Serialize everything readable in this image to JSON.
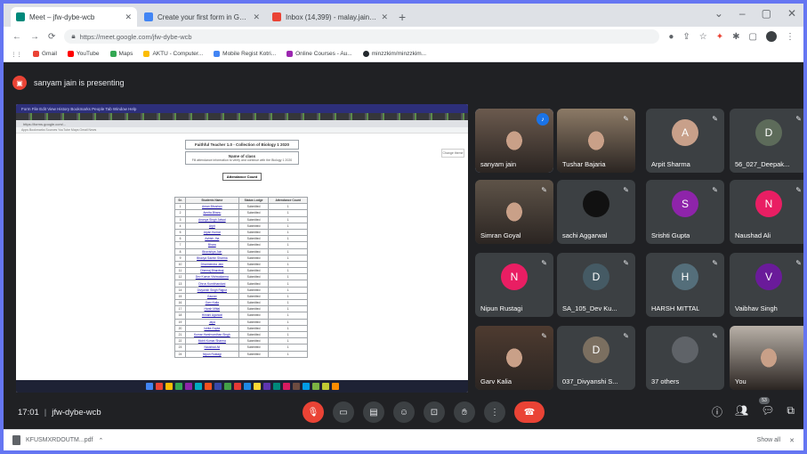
{
  "browser": {
    "tabs": [
      {
        "title": "Meet – jfw-dybe-wcb",
        "color": "#00897b",
        "active": true
      },
      {
        "title": "Create your first form in Google...",
        "color": "#4285f4",
        "active": false
      },
      {
        "title": "Inbox (14,399) - malay.jain@...",
        "color": "#ea4335",
        "active": false
      }
    ],
    "new_tab": "+",
    "window_controls": [
      "⌄",
      "–",
      "▢",
      "✕"
    ],
    "back": "←",
    "forward": "→",
    "reload": "⟳",
    "url": "https://meet.google.com/jfw-dybe-wcb",
    "bookmarks": [
      {
        "label": "Gmail",
        "color": "#ea4335"
      },
      {
        "label": "YouTube",
        "color": "#ff0000"
      },
      {
        "label": "Maps",
        "color": "#34a853"
      },
      {
        "label": "AKTU - Computer...",
        "color": "#fbbc04"
      },
      {
        "label": "Mobile Regist Kotri...",
        "color": "#4285f4"
      },
      {
        "label": "Online Courses - Au...",
        "color": "#9c27b0"
      },
      {
        "label": "minzzkim/minzzkim...",
        "color": "#24292e"
      }
    ]
  },
  "meet": {
    "presenting": "sanyam jain is presenting",
    "screen": {
      "title_bar": "Form  File  Edit  View  History  Bookmarks  People  Tab  Window  Help",
      "address": "https://forms.google.com/...",
      "bookmarks_line": "Apps  Bookmarks  Sources  YouTube  Maps  Gmail  News",
      "side_note": "Change theme",
      "doc_title": "Faithful Teacher 1.0 - Collection of Biology 1 2020",
      "doc_subtitle": "Name of class",
      "doc_desc": "Fill attendance information to verify and continue with the Biology 1 2020",
      "attendance_button": "Attendance Count",
      "table_headers": [
        "Sr.",
        "Students Name",
        "Status Lodge",
        "Attendance Count"
      ],
      "rows": [
        [
          "1",
          "Aman Bhushan",
          "Submitted",
          "1"
        ],
        [
          "2",
          "Amrita Bhanu",
          "Submitted",
          "1"
        ],
        [
          "3",
          "Ananya Singh Jalwal",
          "Submitted",
          "1"
        ],
        [
          "4",
          "Arpit",
          "Submitted",
          "1"
        ],
        [
          "5",
          "Aryan Kumar",
          "Submitted",
          "1"
        ],
        [
          "6",
          "Ashish Jha",
          "Submitted",
          "1"
        ],
        [
          "7",
          "Bhara",
          "Submitted",
          "1"
        ],
        [
          "8",
          "Bhavishya Jain",
          "Submitted",
          "1"
        ],
        [
          "9",
          "Bhavya Sachin Sharma",
          "Submitted",
          "1"
        ],
        [
          "10",
          "Dharmendra Jain",
          "Submitted",
          "1"
        ],
        [
          "11",
          "Dheeraj Bhardwaj",
          "Submitted",
          "1"
        ],
        [
          "12",
          "Dev Kumar Vishwakarma",
          "Submitted",
          "1"
        ],
        [
          "13",
          "Dhruv Kumbhandani",
          "Submitted",
          "1"
        ],
        [
          "14",
          "Divyansh Singh Rajput",
          "Submitted",
          "1"
        ],
        [
          "15",
          "Gaurav",
          "Submitted",
          "1"
        ],
        [
          "16",
          "Garv Kalia",
          "Submitted",
          "1"
        ],
        [
          "17",
          "Harsh Mittal",
          "Submitted",
          "1"
        ],
        [
          "18",
          "Himani Agarwal",
          "Submitted",
          "1"
        ],
        [
          "19",
          "Jaya",
          "Submitted",
          "1"
        ],
        [
          "20",
          "Ishita Gupta",
          "Submitted",
          "1"
        ],
        [
          "21",
          "Kumar Harshvardhan Singh",
          "Submitted",
          "1"
        ],
        [
          "22",
          "Mohit Kumar Sharma",
          "Submitted",
          "1"
        ],
        [
          "23",
          "Naushad Ali",
          "Submitted",
          "1"
        ],
        [
          "24",
          "Nipun Rustagi",
          "Submitted",
          "1"
        ]
      ],
      "taskbar_colors": [
        "#4285f4",
        "#ea4335",
        "#fbbc04",
        "#34a853",
        "#8e24aa",
        "#00acc1",
        "#f4511e",
        "#3949ab",
        "#43a047",
        "#e53935",
        "#1e88e5",
        "#fdd835",
        "#5e35b1",
        "#00897b",
        "#d81b60",
        "#6d4c41",
        "#039be5",
        "#7cb342",
        "#c0ca33",
        "#fb8c00"
      ]
    },
    "tiles": [
      {
        "name": "sanyam jain",
        "type": "camera",
        "bg": "#6b5a4e",
        "speaking": true
      },
      {
        "name": "Tushar Bajaria",
        "type": "camera",
        "bg": "#8c7a66",
        "speaking": false
      },
      {
        "name": "Arpit Sharma",
        "type": "avatar",
        "initial": "A",
        "avatar_color": "#c8a08a"
      },
      {
        "name": "56_027_Deepak...",
        "type": "avatar",
        "initial": "D",
        "avatar_color": "#5d6b5a"
      },
      {
        "name": "Simran Goyal",
        "type": "camera",
        "bg": "#5e5348",
        "speaking": false
      },
      {
        "name": "sachi Aggarwal",
        "type": "avatar",
        "initial": "",
        "avatar_color": "#111111"
      },
      {
        "name": "Srishti Gupta",
        "type": "avatar",
        "initial": "S",
        "avatar_color": "#8e24aa"
      },
      {
        "name": "Naushad Ali",
        "type": "avatar",
        "initial": "N",
        "avatar_color": "#e91e63"
      },
      {
        "name": "Nipun Rustagi",
        "type": "avatar",
        "initial": "N",
        "avatar_color": "#e91e63"
      },
      {
        "name": "SA_105_Dev Ku...",
        "type": "avatar",
        "initial": "D",
        "avatar_color": "#455a64"
      },
      {
        "name": "HARSH MITTAL",
        "type": "avatar",
        "initial": "H",
        "avatar_color": "#546e7a"
      },
      {
        "name": "Vaibhav Singh",
        "type": "avatar",
        "initial": "V",
        "avatar_color": "#6a1b9a"
      },
      {
        "name": "Garv Kalia",
        "type": "camera",
        "bg": "#4e3b30",
        "speaking": false
      },
      {
        "name": "037_Divyanshi S...",
        "type": "avatar",
        "initial": "D",
        "avatar_color": "#7b6f60"
      },
      {
        "name": "37 others",
        "type": "avatar",
        "initial": "",
        "avatar_color": "#5f6368"
      },
      {
        "name": "You",
        "type": "camera",
        "bg": "#b9b1a8",
        "speaking": false
      }
    ],
    "bottom": {
      "time": "17:01",
      "meeting_code": "jfw-dybe-wcb",
      "people_count": "53"
    }
  },
  "download": {
    "file": "KFUSMXRDOUTM...pdf",
    "chevron": "⌃",
    "show_all": "Show all",
    "close": "✕"
  }
}
